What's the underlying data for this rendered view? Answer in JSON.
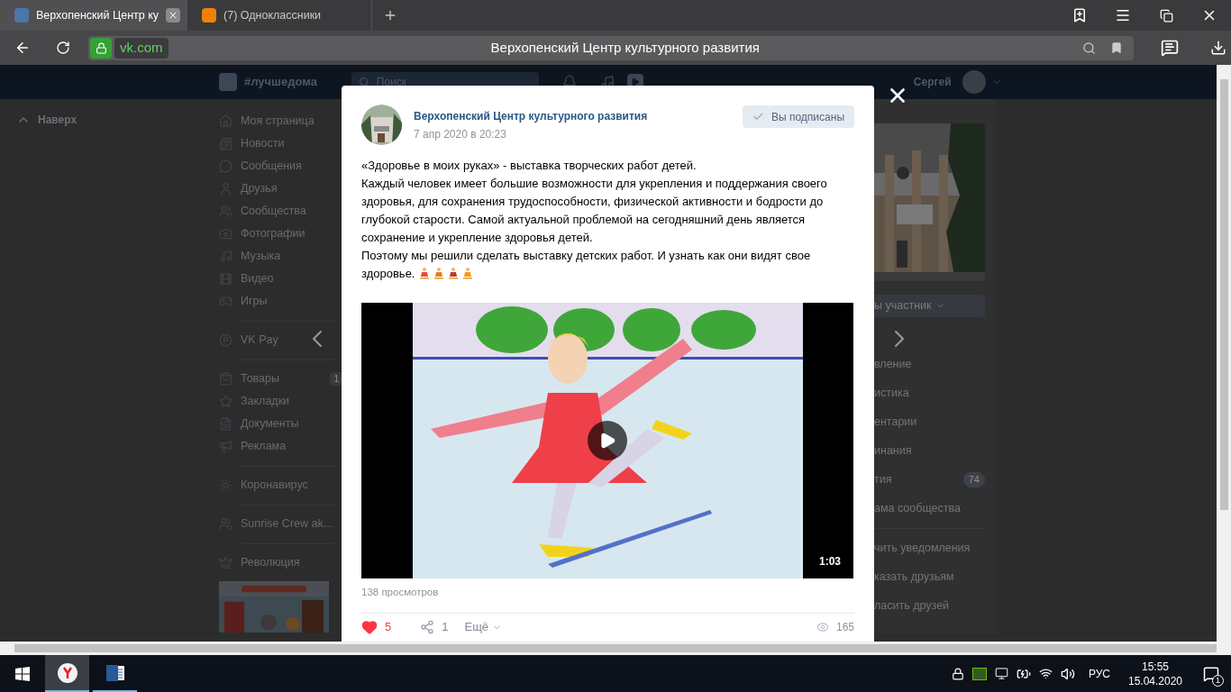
{
  "browser": {
    "tabs": [
      {
        "title": "Верхопенский Центр ку",
        "kind": "vk",
        "selected": true
      },
      {
        "title": "(7) Одноклассники",
        "kind": "ok",
        "selected": false
      }
    ],
    "address": {
      "domain": "vk.com",
      "title": "Верхопенский Центр культурного развития"
    }
  },
  "vk_header": {
    "hashtag": "#лучшедома",
    "search_placeholder": "Поиск",
    "user": "Сергей"
  },
  "back_to_top": "Наверх",
  "nav_groups": [
    [
      {
        "label": "Моя страница"
      },
      {
        "label": "Новости"
      },
      {
        "label": "Сообщения"
      },
      {
        "label": "Друзья"
      },
      {
        "label": "Сообщества"
      },
      {
        "label": "Фотографии"
      },
      {
        "label": "Музыка"
      },
      {
        "label": "Видео"
      },
      {
        "label": "Игры"
      }
    ],
    [
      {
        "label": "VK Pay"
      }
    ],
    [
      {
        "label": "Товары",
        "badge": "1"
      },
      {
        "label": "Закладки"
      },
      {
        "label": "Документы"
      },
      {
        "label": "Реклама"
      }
    ],
    [
      {
        "label": "Коронавирус"
      }
    ],
    [
      {
        "label": "Sunrise Crew ak..."
      }
    ],
    [
      {
        "label": "Революция"
      }
    ]
  ],
  "right_panel": {
    "member_button": "ы участник",
    "menu_groups": [
      [
        {
          "label": "вление"
        },
        {
          "label": "истика"
        },
        {
          "label": "ентарии"
        },
        {
          "label": "инания"
        },
        {
          "label": "тия",
          "badge": "74"
        },
        {
          "label": "ама сообщества"
        }
      ],
      [
        {
          "label": "чить уведомления"
        },
        {
          "label": "казать друзьям"
        },
        {
          "label": "ласить друзей"
        }
      ]
    ]
  },
  "post": {
    "author": "Верхопенский Центр культурного развития",
    "date": "7 апр 2020 в 20:23",
    "subscribe_button": "Вы подписаны",
    "paragraphs": [
      "«Здоровье в моих руках» - выставка творческих работ детей.",
      "Каждый человек имеет большие возможности для укрепления и поддержания своего здоровья, для сохранения трудоспособности, физической активности и бодрости до глубокой старости. Самой актуальной проблемой на сегодняшний день является сохранение и укрепление здоровья детей.",
      "Поэтому мы решили сделать выставку детских работ. И узнать как они видят свое здоровье."
    ],
    "video": {
      "duration": "1:03"
    },
    "views": "138 просмотров",
    "likes": "5",
    "liked": true,
    "shares": "1",
    "more": "Ещё",
    "view_count": "165"
  },
  "taskbar": {
    "apps": [
      {
        "kind": "yandex",
        "selected": true
      },
      {
        "kind": "word",
        "selected": false
      }
    ],
    "language": "РУС",
    "time": "15:55",
    "date": "15.04.2020",
    "notifications": "1"
  }
}
